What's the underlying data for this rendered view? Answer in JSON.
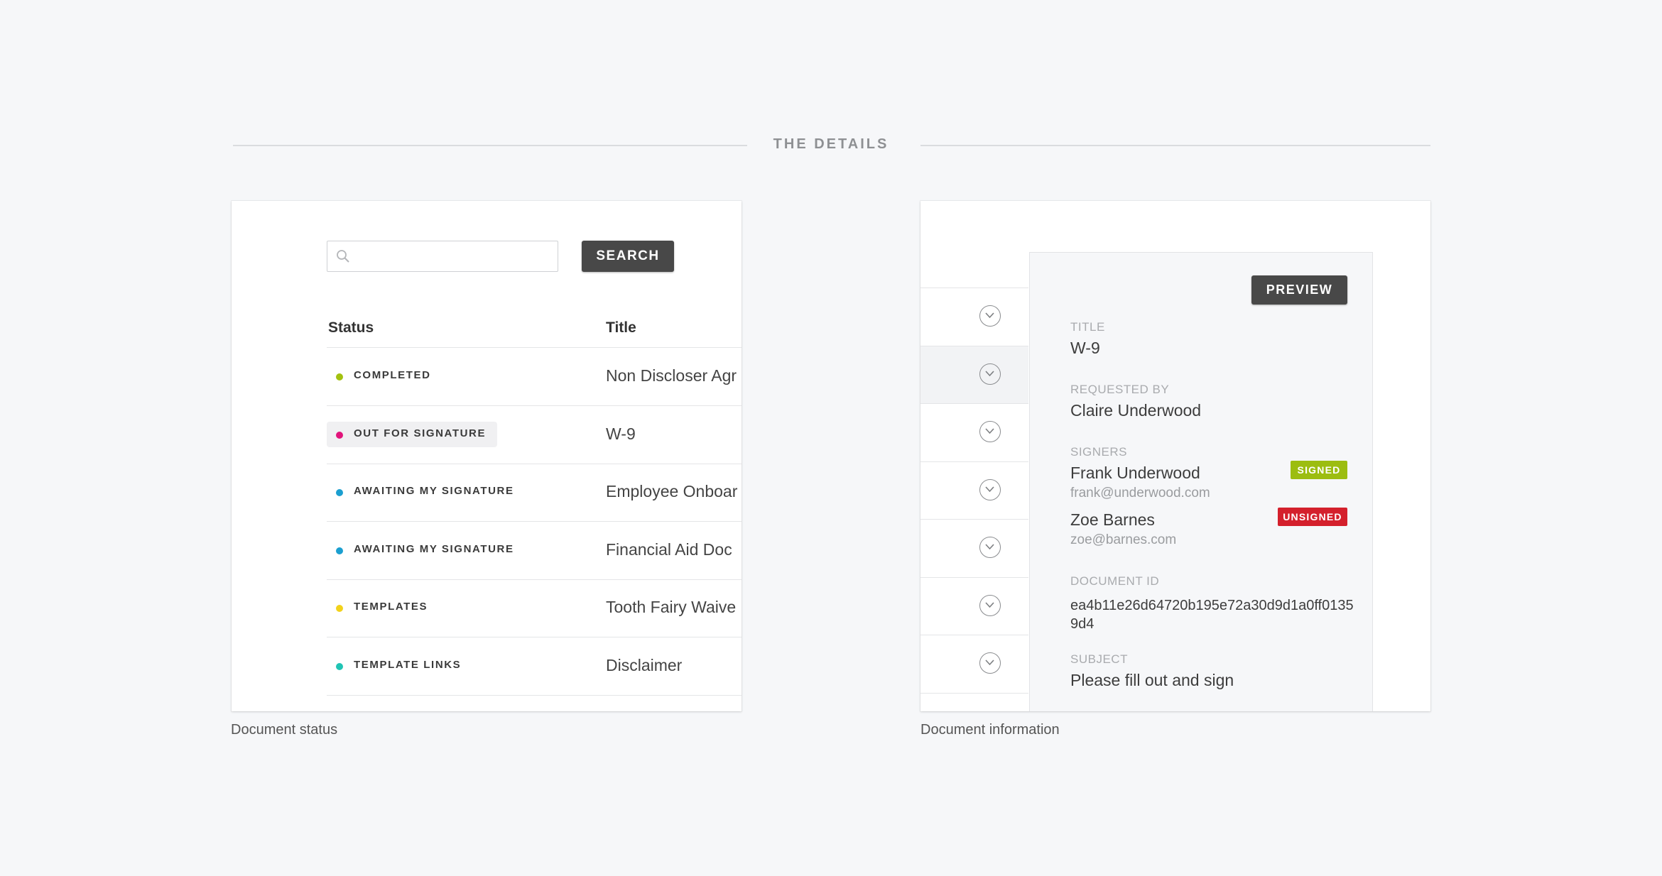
{
  "header": {
    "section_title": "THE DETAILS"
  },
  "status_card": {
    "caption": "Document status",
    "search": {
      "placeholder": "",
      "button_label": "SEARCH"
    },
    "columns": {
      "status": "Status",
      "title": "Title"
    },
    "rows": [
      {
        "status": "COMPLETED",
        "title": "Non Discloser Agr",
        "dot_color": "#a3c10f",
        "highlighted": false
      },
      {
        "status": "OUT FOR SIGNATURE",
        "title": "W-9",
        "dot_color": "#e1147b",
        "highlighted": true
      },
      {
        "status": "AWAITING MY SIGNATURE",
        "title": "Employee Onboar",
        "dot_color": "#1b9fd0",
        "highlighted": false
      },
      {
        "status": "AWAITING MY SIGNATURE",
        "title": "Financial Aid Doc",
        "dot_color": "#1b9fd0",
        "highlighted": false
      },
      {
        "status": "TEMPLATES",
        "title": "Tooth Fairy Waive",
        "dot_color": "#f2d21b",
        "highlighted": false
      },
      {
        "status": "TEMPLATE LINKS",
        "title": "Disclaimer",
        "dot_color": "#20c4b4",
        "highlighted": false
      }
    ]
  },
  "info_card": {
    "caption": "Document information",
    "preview_label": "PREVIEW",
    "fields": {
      "title_label": "TITLE",
      "title_value": "W-9",
      "requested_by_label": "REQUESTED BY",
      "requested_by_value": "Claire Underwood",
      "signers_label": "SIGNERS",
      "document_id_label": "DOCUMENT ID",
      "document_id_value": "ea4b11e26d64720b195e72a30d9d1a0ff01359d4",
      "subject_label": "SUBJECT",
      "subject_value": "Please fill out and sign"
    },
    "signers": [
      {
        "name": "Frank Underwood",
        "email": "frank@underwood.com",
        "badge": "SIGNED",
        "badge_color": "#9cbd10"
      },
      {
        "name": "Zoe Barnes",
        "email": "zoe@barnes.com",
        "badge": "UNSIGNED",
        "badge_color": "#d4202c"
      }
    ]
  },
  "colors": {
    "button_dark": "#484848",
    "background": "#f6f7f9"
  }
}
